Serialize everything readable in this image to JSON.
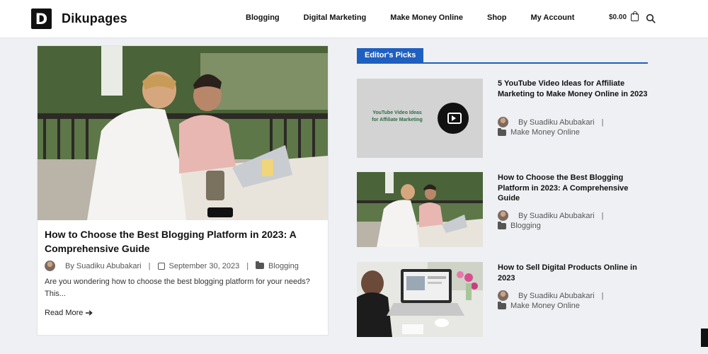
{
  "site": {
    "logo_letter": "D",
    "name": "Dikupages"
  },
  "nav": {
    "items": [
      "Blogging",
      "Digital Marketing",
      "Make Money Online",
      "Shop",
      "My Account"
    ]
  },
  "cart": {
    "amount": "$0.00"
  },
  "featured": {
    "title": "How to Choose the Best Blogging Platform in 2023: A Comprehensive Guide",
    "author": "By Suadiku Abubakari",
    "separator": "|",
    "date": "September 30, 2023",
    "category": "Blogging",
    "excerpt": "Are you wondering how to choose the best blogging platform for your needs? This...",
    "read_more": "Read More"
  },
  "picks": {
    "heading": "Editor's Picks",
    "items": [
      {
        "title": "5 YouTube Video Ideas for Affiliate Marketing to Make Money Online in 2023",
        "author": "By Suadiku Abubakari",
        "separator": "|",
        "category": "Make Money Online",
        "thumb_text": "YouTube Video Ideas for Affiliate Marketing"
      },
      {
        "title": "How to Choose the Best Blogging Platform in 2023: A Comprehensive Guide",
        "author": "By Suadiku Abubakari",
        "separator": "|",
        "category": "Blogging"
      },
      {
        "title": "How to Sell Digital Products Online in 2023",
        "author": "By Suadiku Abubakari",
        "separator": "|",
        "category": "Make Money Online"
      }
    ]
  },
  "colors": {
    "accent": "#1f5fbf",
    "background": "#eef0f3",
    "text": "#111111"
  },
  "icons": [
    "cart-icon",
    "search-icon",
    "calendar-icon",
    "folder-icon",
    "arrow-right-icon",
    "play-icon"
  ]
}
